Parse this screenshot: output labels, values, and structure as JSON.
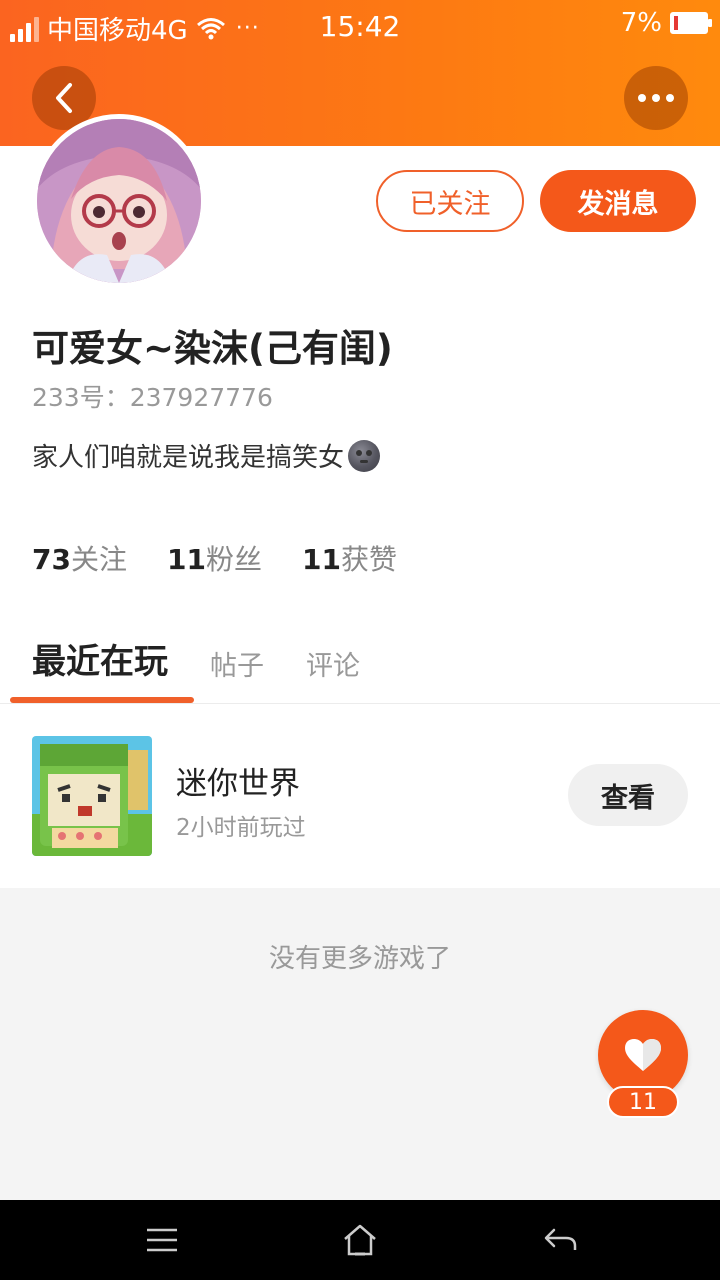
{
  "status_bar": {
    "carrier": "中国移动4G",
    "more_dots": "···",
    "time": "15:42",
    "battery_percent": "7%",
    "battery_level": 0.07
  },
  "header": {
    "back_icon": "chevron-left-icon",
    "more_icon": "more-dots-icon"
  },
  "profile": {
    "username": "可爱女~染沫(己有闺)",
    "id_label": "233号：",
    "id_value": "237927776",
    "bio": "家人们咱就是说我是搞笑女",
    "bio_emoji": "new-moon-face-emoji",
    "follow_button": "已关注",
    "message_button": "发消息"
  },
  "stats": [
    {
      "num": "73",
      "label": "关注"
    },
    {
      "num": "11",
      "label": "粉丝"
    },
    {
      "num": "11",
      "label": "获赞"
    }
  ],
  "tabs": [
    {
      "label": "最近在玩",
      "active": true
    },
    {
      "label": "帖子",
      "active": false
    },
    {
      "label": "评论",
      "active": false
    }
  ],
  "recent_games": [
    {
      "name": "迷你世界",
      "subtitle": "2小时前玩过",
      "button": "查看"
    }
  ],
  "footer_text": "没有更多游戏了",
  "like": {
    "count": "11",
    "icon": "heart-icon"
  },
  "nav_bar": {
    "menu_icon": "menu-icon",
    "home_icon": "home-icon",
    "back_icon": "return-icon"
  },
  "colors": {
    "accent": "#f4581a",
    "header_start": "#fb6420",
    "header_end": "#ff8a0d"
  }
}
